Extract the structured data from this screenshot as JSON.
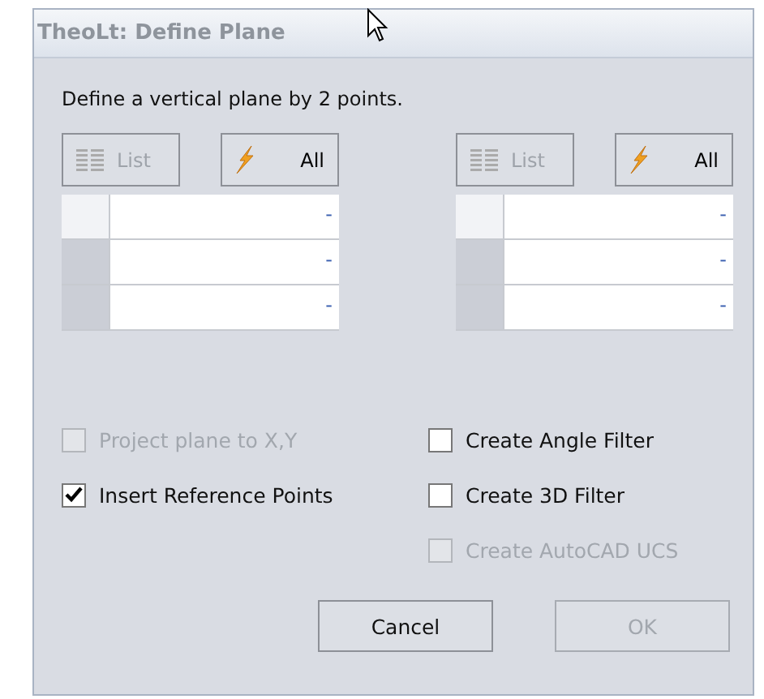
{
  "window": {
    "title": "TheoLt: Define Plane"
  },
  "instruction": "Define a vertical plane by 2 points.",
  "panels": [
    {
      "list_button": {
        "label": "List",
        "disabled": true
      },
      "all_button": {
        "label": "All",
        "disabled": false
      },
      "rows": [
        {
          "value": "-",
          "selected": true
        },
        {
          "value": "-",
          "selected": false
        },
        {
          "value": "-",
          "selected": false
        }
      ]
    },
    {
      "list_button": {
        "label": "List",
        "disabled": true
      },
      "all_button": {
        "label": "All",
        "disabled": false
      },
      "rows": [
        {
          "value": "-",
          "selected": true
        },
        {
          "value": "-",
          "selected": false
        },
        {
          "value": "-",
          "selected": false
        }
      ]
    }
  ],
  "options_left": [
    {
      "label": "Project plane to X,Y",
      "checked": false,
      "disabled": true
    },
    {
      "label": "Insert Reference Points",
      "checked": true,
      "disabled": false
    }
  ],
  "options_right": [
    {
      "label": "Create Angle Filter",
      "checked": false,
      "disabled": false
    },
    {
      "label": "Create 3D Filter",
      "checked": false,
      "disabled": false
    },
    {
      "label": "Create AutoCAD UCS",
      "checked": false,
      "disabled": true
    }
  ],
  "buttons": [
    {
      "label": "Cancel",
      "disabled": false
    },
    {
      "label": "OK",
      "disabled": true
    }
  ]
}
